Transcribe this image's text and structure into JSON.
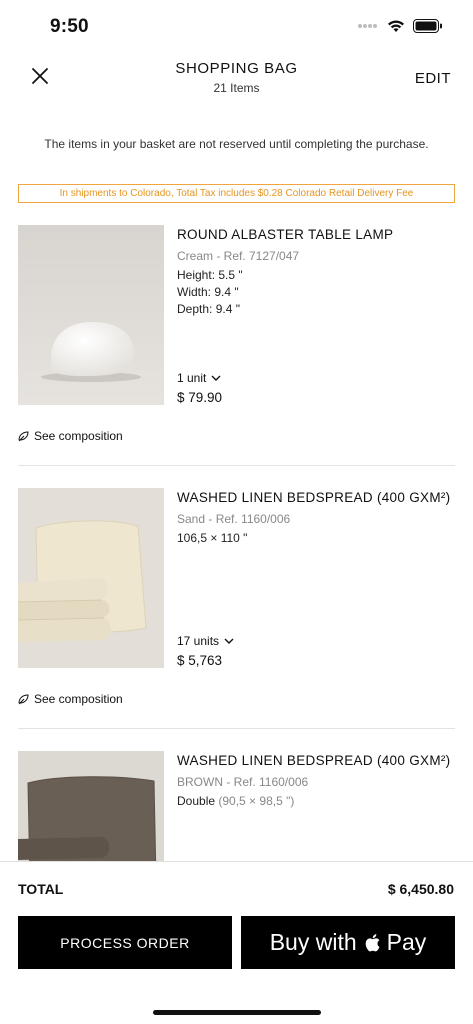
{
  "status": {
    "time": "9:50",
    "icons": [
      "signal-icon",
      "wifi-icon",
      "battery-icon"
    ]
  },
  "header": {
    "title": "SHOPPING BAG",
    "item_count": "21 Items",
    "edit_label": "EDIT",
    "close_icon": "close-icon"
  },
  "notice": "The items in your basket are not reserved until completing the purchase.",
  "tax_banner": "In shipments to Colorado, Total Tax includes $0.28 Colorado Retail Delivery Fee",
  "products": [
    {
      "name": "ROUND ALBASTER TABLE LAMP",
      "ref": "Cream - Ref. 7127/047",
      "details": [
        "Height: 5.5 \"",
        "Width: 9.4 \"",
        "Depth: 9.4 \""
      ],
      "qty": "1 unit",
      "price": "$ 79.90",
      "composition": "See composition"
    },
    {
      "name": "WASHED LINEN BEDSPREAD (400 GXM²)",
      "ref": "Sand - Ref. 1160/006",
      "details": [
        "106,5 × 110 \""
      ],
      "qty": "17 units",
      "price": "$ 5,763",
      "composition": "See composition"
    },
    {
      "name": "WASHED LINEN BEDSPREAD (400 GXM²)",
      "ref": "BROWN - Ref. 1160/006",
      "details_main": "Double",
      "details_sub": "(90,5 × 98,5 \")"
    }
  ],
  "footer": {
    "total_label": "TOTAL",
    "total_value": "$ 6,450.80",
    "process_label": "PROCESS ORDER",
    "apple_pay_prefix": "Buy with",
    "apple_pay_suffix": "Pay"
  },
  "colors": {
    "accent_orange": "#e69520",
    "button_black": "#000000"
  }
}
